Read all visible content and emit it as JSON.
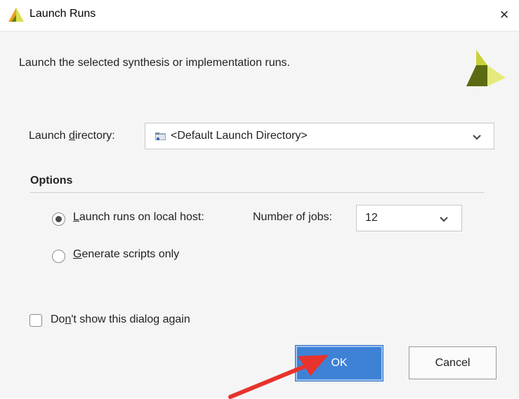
{
  "window": {
    "title": "Launch Runs",
    "close_icon": "×"
  },
  "description": "Launch the selected synthesis or implementation runs.",
  "launch_directory": {
    "label_prefix": "Launch ",
    "label_mnemonic": "d",
    "label_suffix": "irectory:",
    "value": "<Default Launch Directory>"
  },
  "options": {
    "title": "Options",
    "local_host": {
      "mnemonic": "L",
      "label_rest": "aunch runs on local host:",
      "selected": true
    },
    "jobs": {
      "label_prefix": "Number of ",
      "label_mnemonic": "j",
      "label_suffix": "obs:",
      "value": "12"
    },
    "scripts_only": {
      "mnemonic": "G",
      "label_rest": "enerate scripts only",
      "selected": false
    }
  },
  "dont_show": {
    "label_prefix": "Do",
    "label_mnemonic": "n",
    "label_suffix": "'t show this dialog again",
    "checked": false
  },
  "buttons": {
    "ok": "OK",
    "cancel": "Cancel"
  },
  "colors": {
    "accent": "#3e82d6",
    "annotation_arrow": "#e8322d",
    "logo_light": "#c9d13a",
    "logo_dark": "#5a6b12"
  }
}
